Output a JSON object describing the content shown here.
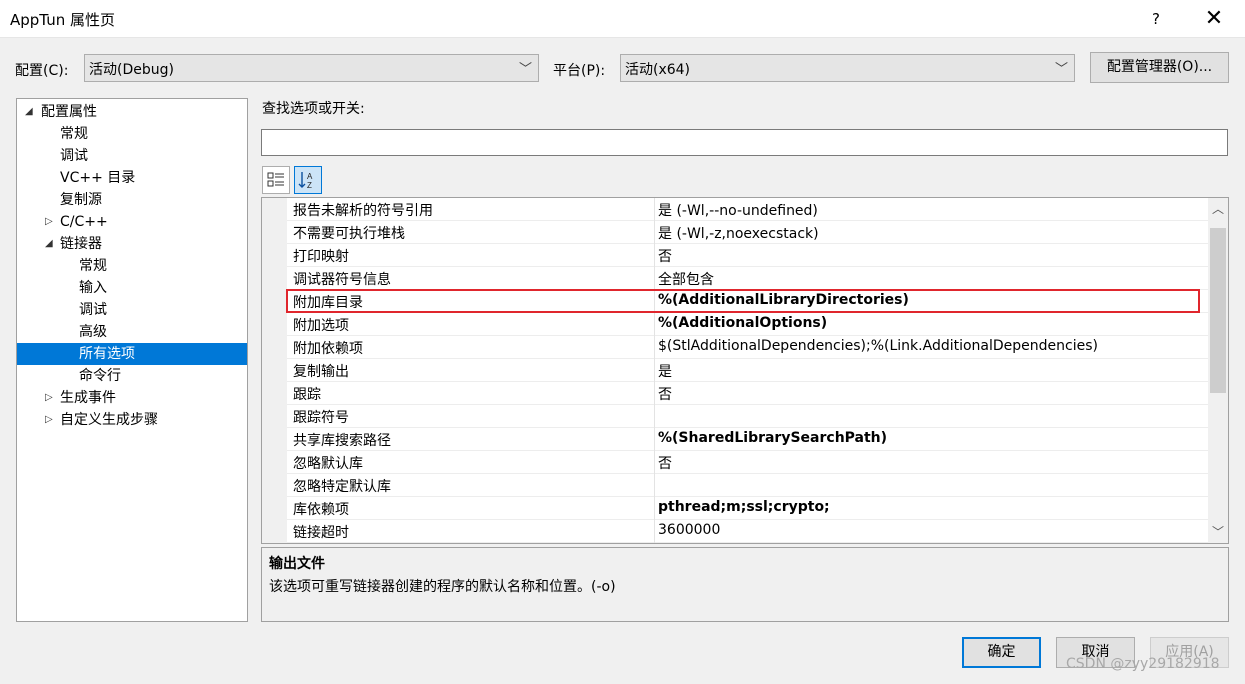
{
  "window": {
    "title": "AppTun 属性页",
    "help": "?",
    "close": "✕"
  },
  "config": {
    "label": "配置(C):",
    "value": "活动(Debug)"
  },
  "platform": {
    "label": "平台(P):",
    "value": "活动(x64)"
  },
  "config_manager_label": "配置管理器(O)...",
  "search_label": "查找选项或开关:",
  "search_value": "",
  "toolbar": {
    "categorized_icon": "categorized-view-icon",
    "sort_icon": "sort-az-icon"
  },
  "tree": {
    "items": [
      {
        "label": "配置属性",
        "expander": "◢"
      },
      {
        "label": "常规"
      },
      {
        "label": "调试"
      },
      {
        "label": "VC++ 目录"
      },
      {
        "label": "复制源"
      },
      {
        "label": "C/C++",
        "expander": "▷"
      },
      {
        "label": "链接器",
        "expander": "◢"
      },
      {
        "label": "常规"
      },
      {
        "label": "输入"
      },
      {
        "label": "调试"
      },
      {
        "label": "高级"
      },
      {
        "label": "所有选项",
        "selected": true
      },
      {
        "label": "命令行"
      },
      {
        "label": "生成事件",
        "expander": "▷"
      },
      {
        "label": "自定义生成步骤",
        "expander": "▷"
      }
    ]
  },
  "grid": {
    "rows": [
      {
        "name": "报告未解析的符号引用",
        "value": "是 (-Wl,--no-undefined)",
        "bold": false
      },
      {
        "name": "不需要可执行堆栈",
        "value": "是 (-Wl,-z,noexecstack)",
        "bold": false
      },
      {
        "name": "打印映射",
        "value": "否",
        "bold": false
      },
      {
        "name": "调试器符号信息",
        "value": "全部包含",
        "bold": false
      },
      {
        "name": "附加库目录",
        "value": "%(AdditionalLibraryDirectories)",
        "bold": true
      },
      {
        "name": "附加选项",
        "value": "%(AdditionalOptions)",
        "bold": true
      },
      {
        "name": "附加依赖项",
        "value": "$(StlAdditionalDependencies);%(Link.AdditionalDependencies)",
        "bold": false
      },
      {
        "name": "复制输出",
        "value": "是",
        "bold": false
      },
      {
        "name": "跟踪",
        "value": "否",
        "bold": false
      },
      {
        "name": "跟踪符号",
        "value": "",
        "bold": false
      },
      {
        "name": "共享库搜索路径",
        "value": "%(SharedLibrarySearchPath)",
        "bold": true
      },
      {
        "name": "忽略默认库",
        "value": "否",
        "bold": false
      },
      {
        "name": "忽略特定默认库",
        "value": "",
        "bold": false
      },
      {
        "name": "库依赖项",
        "value": "pthread;m;ssl;crypto;",
        "bold": true
      },
      {
        "name": "链接超时",
        "value": "3600000",
        "bold": false
      }
    ],
    "highlight_color": "#e0262d"
  },
  "description": {
    "title": "输出文件",
    "text": "该选项可重写链接器创建的程序的默认名称和位置。(-o)"
  },
  "buttons": {
    "ok": "确定",
    "cancel": "取消",
    "apply": "应用(A)"
  },
  "watermark": "CSDN @zyy29182918",
  "colors": {
    "selection": "#0078d7",
    "highlight": "#e0262d"
  }
}
